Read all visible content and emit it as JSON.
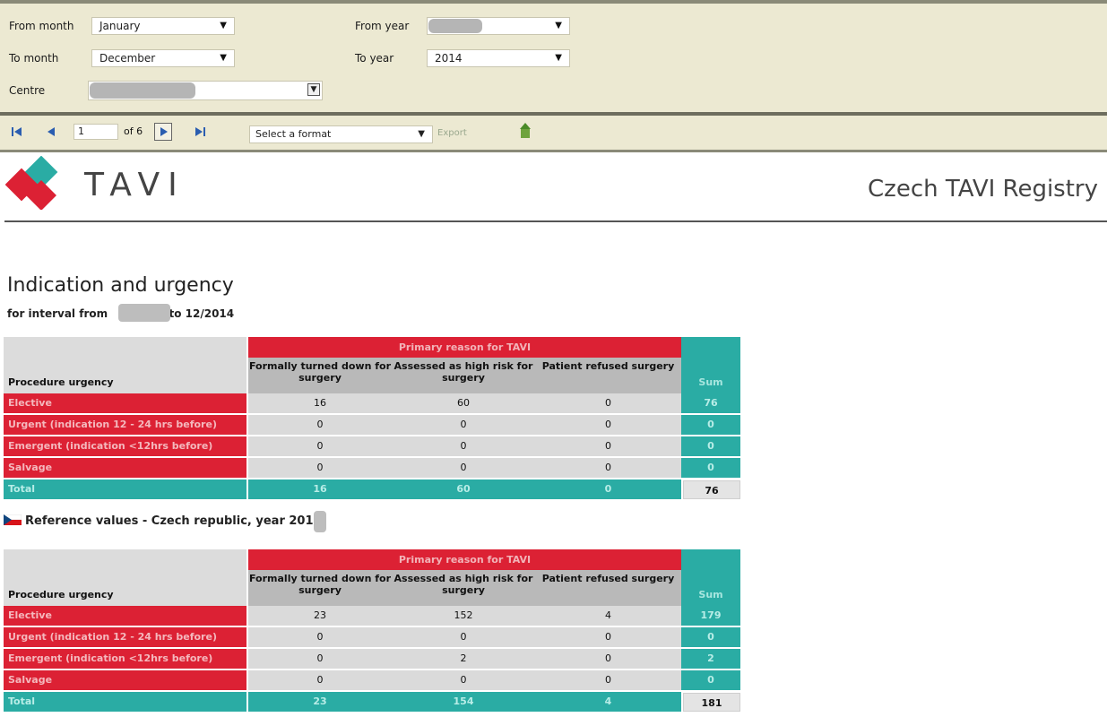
{
  "params": {
    "from_month_label": "From month",
    "from_month_value": "January",
    "from_year_label": "From year",
    "from_year_value": "",
    "to_month_label": "To month",
    "to_month_value": "December",
    "to_year_label": "To year",
    "to_year_value": "2014",
    "centre_label": "Centre",
    "centre_value": ""
  },
  "toolbar": {
    "page_value": "1",
    "page_of": "of 6",
    "format_value": "Select a format",
    "export_label": "Export"
  },
  "header": {
    "logo_text": "TAVI",
    "registry_title": "Czech TAVI Registry"
  },
  "report": {
    "title": "Indication and urgency",
    "subtitle_prefix": "for interval from",
    "subtitle_suffix": "to 12/2014"
  },
  "table1": {
    "corner": "Procedure urgency",
    "group_header": "Primary reason for TAVI",
    "sum_header": "Sum",
    "columns": [
      "Formally turned down for surgery",
      "Assessed as high risk for surgery",
      "Patient refused surgery"
    ],
    "rows": [
      {
        "label": "Elective",
        "values": [
          "16",
          "60",
          "0"
        ],
        "sum": "76"
      },
      {
        "label": "Urgent (indication 12 - 24 hrs before)",
        "values": [
          "0",
          "0",
          "0"
        ],
        "sum": "0"
      },
      {
        "label": "Emergent (indication <12hrs before)",
        "values": [
          "0",
          "0",
          "0"
        ],
        "sum": "0"
      },
      {
        "label": "Salvage",
        "values": [
          "0",
          "0",
          "0"
        ],
        "sum": "0"
      }
    ],
    "total_label": "Total",
    "total_values": [
      "16",
      "60",
      "0"
    ],
    "grand_total": "76"
  },
  "reference": {
    "text": "Reference values - Czech republic, year 201"
  },
  "table2": {
    "corner": "Procedure urgency",
    "group_header": "Primary reason for TAVI",
    "sum_header": "Sum",
    "columns": [
      "Formally turned down for surgery",
      "Assessed as high risk for surgery",
      "Patient refused surgery"
    ],
    "rows": [
      {
        "label": "Elective",
        "values": [
          "23",
          "152",
          "4"
        ],
        "sum": "179"
      },
      {
        "label": "Urgent (indication 12 - 24 hrs before)",
        "values": [
          "0",
          "0",
          "0"
        ],
        "sum": "0"
      },
      {
        "label": "Emergent (indication <12hrs before)",
        "values": [
          "0",
          "2",
          "0"
        ],
        "sum": "2"
      },
      {
        "label": "Salvage",
        "values": [
          "0",
          "0",
          "0"
        ],
        "sum": "0"
      }
    ],
    "total_label": "Total",
    "total_values": [
      "23",
      "154",
      "4"
    ],
    "grand_total": "181"
  }
}
